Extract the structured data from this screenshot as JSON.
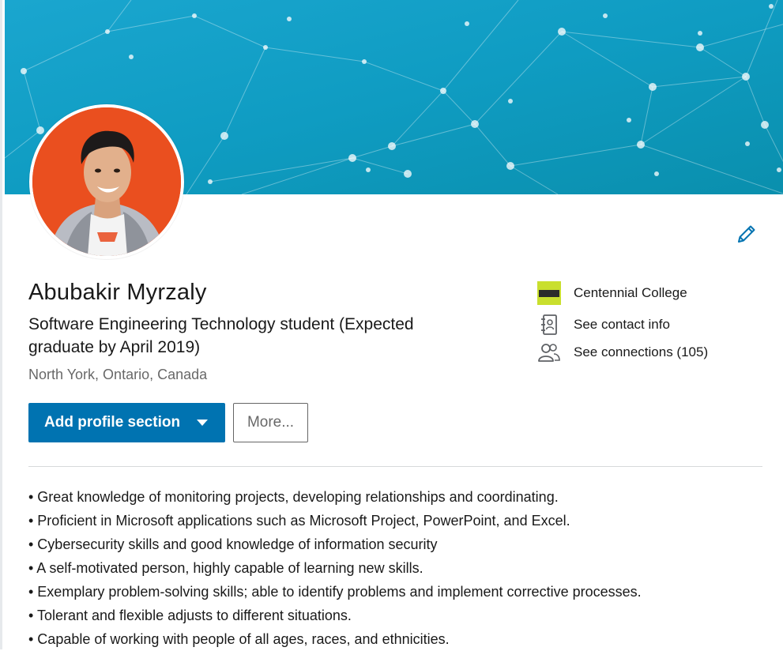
{
  "profile": {
    "name": "Abubakir Myrzaly",
    "headline": "Software Engineering Technology student (Expected graduate by April 2019)",
    "location": "North York, Ontario, Canada"
  },
  "actions": {
    "add_section_label": "Add profile section",
    "more_label": "More..."
  },
  "side": {
    "education": "Centennial College",
    "contact": "See contact info",
    "connections": "See connections (105)"
  },
  "about": [
    "• Great knowledge of monitoring projects, developing relationships and coordinating.",
    "• Proficient in Microsoft applications such as Microsoft Project, PowerPoint, and Excel.",
    "• Cybersecurity skills and good knowledge of information security",
    "• A self-motivated person, highly capable of learning new skills.",
    "• Exemplary problem-solving skills; able to identify problems and implement corrective processes.",
    "• Tolerant and flexible adjusts to different situations.",
    "• Capable of working with people of all ages, races, and ethnicities."
  ],
  "icons": {
    "edit": "pencil-icon",
    "education": "college-logo",
    "contact": "contact-card-icon",
    "connections": "people-icon",
    "dropdown": "caret-down-icon"
  },
  "colors": {
    "primary": "#0073b1",
    "banner_start": "#1aa0c9",
    "banner_end": "#0a8fb0",
    "avatar_bg": "#e8491d",
    "college_logo": "#c9df2e"
  }
}
